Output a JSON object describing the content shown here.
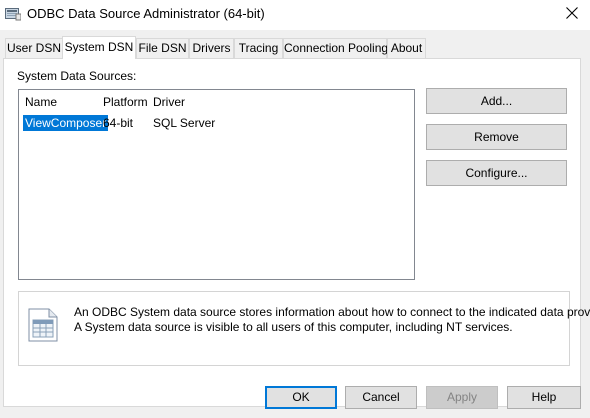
{
  "window": {
    "title": "ODBC Data Source Administrator (64-bit)"
  },
  "tabs": [
    {
      "label": "User DSN",
      "active": false
    },
    {
      "label": "System DSN",
      "active": true
    },
    {
      "label": "File DSN",
      "active": false
    },
    {
      "label": "Drivers",
      "active": false
    },
    {
      "label": "Tracing",
      "active": false
    },
    {
      "label": "Connection Pooling",
      "active": false
    },
    {
      "label": "About",
      "active": false
    }
  ],
  "panel": {
    "section_label": "System Data Sources:",
    "columns": [
      "Name",
      "Platform",
      "Driver"
    ],
    "rows": [
      {
        "name": "ViewComposer",
        "platform": "64-bit",
        "driver": "SQL Server",
        "selected": true
      }
    ],
    "side_buttons": {
      "add": "Add...",
      "remove": "Remove",
      "configure": "Configure..."
    },
    "info": {
      "line1": "An ODBC System data source stores information about how to connect to the indicated data provider.",
      "line2": "A System data source is visible to all users of this computer, including NT services."
    }
  },
  "footer": {
    "ok": "OK",
    "cancel": "Cancel",
    "apply": "Apply",
    "help": "Help",
    "apply_disabled": true
  },
  "colors": {
    "selection": "#0078d7",
    "dialog_bg": "#f0f0f0",
    "button_bg": "#e1e1e1"
  },
  "icons": {
    "app": "odbc-app-icon",
    "close": "close-icon",
    "info": "data-document-icon"
  }
}
